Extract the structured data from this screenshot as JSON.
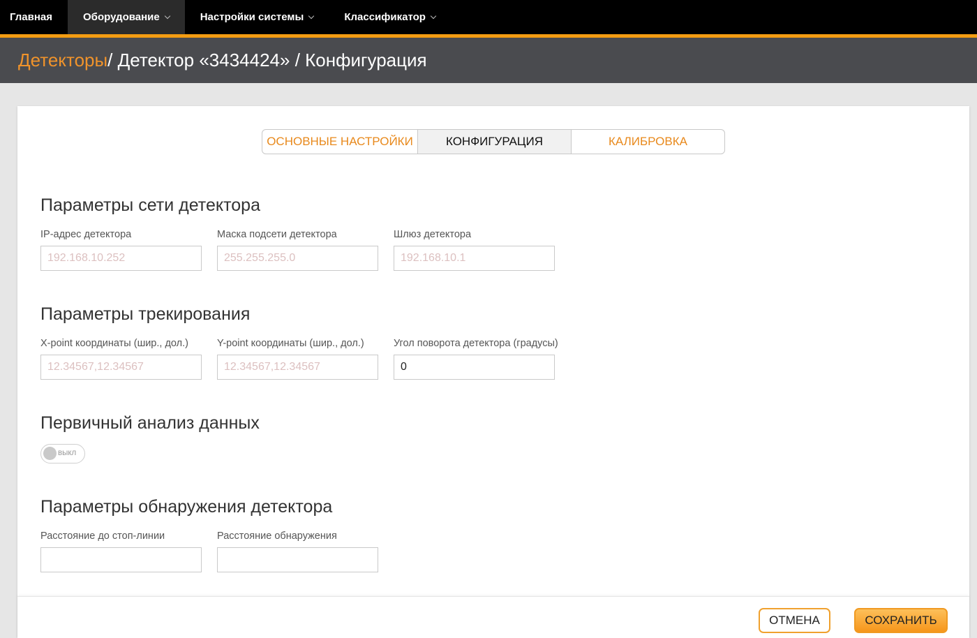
{
  "nav": {
    "items": [
      {
        "label": "Главная",
        "active": false,
        "dropdown": false
      },
      {
        "label": "Оборудование",
        "active": true,
        "dropdown": true
      },
      {
        "label": "Настройки системы",
        "active": false,
        "dropdown": true
      },
      {
        "label": "Классификатор",
        "active": false,
        "dropdown": true
      }
    ]
  },
  "breadcrumb": {
    "link": "Детекторы",
    "rest": " / Детектор «3434424» / Конфигурация"
  },
  "tabs": [
    {
      "label": "Основные настройки",
      "active": false
    },
    {
      "label": "Конфигурация",
      "active": true
    },
    {
      "label": "Калибровка",
      "active": false
    }
  ],
  "network": {
    "title": "Параметры сети детектора",
    "ip": {
      "label": "IP-адрес детектора",
      "value": "",
      "placeholder": "192.168.10.252"
    },
    "mask": {
      "label": "Маска подсети детектора",
      "value": "",
      "placeholder": "255.255.255.0"
    },
    "gateway": {
      "label": "Шлюз детектора",
      "value": "",
      "placeholder": "192.168.10.1"
    }
  },
  "tracking": {
    "title": "Параметры трекирования",
    "xpoint": {
      "label": "X-point координаты (шир., дол.)",
      "value": "",
      "placeholder": "12.34567,12.34567"
    },
    "ypoint": {
      "label": "Y-point координаты (шир., дол.)",
      "value": "",
      "placeholder": "12.34567,12.34567"
    },
    "angle": {
      "label": "Угол поворота детектора (градусы)",
      "value": "0",
      "placeholder": ""
    }
  },
  "primary": {
    "title": "Первичный анализ данных",
    "toggle_label": "выкл",
    "enabled": false
  },
  "detection": {
    "title": "Параметры обнаружения детектора",
    "stopline": {
      "label": "Расстояние до стоп-линии",
      "value": "",
      "placeholder": ""
    },
    "distance": {
      "label": "Расстояние обнаружения",
      "value": "",
      "placeholder": ""
    }
  },
  "footer": {
    "cancel_label": "Отмена",
    "save_label": "Сохранить"
  },
  "colors": {
    "accent": "#f39c12",
    "nav_bg": "#000000",
    "crumb_bg": "#4a4b4f"
  }
}
